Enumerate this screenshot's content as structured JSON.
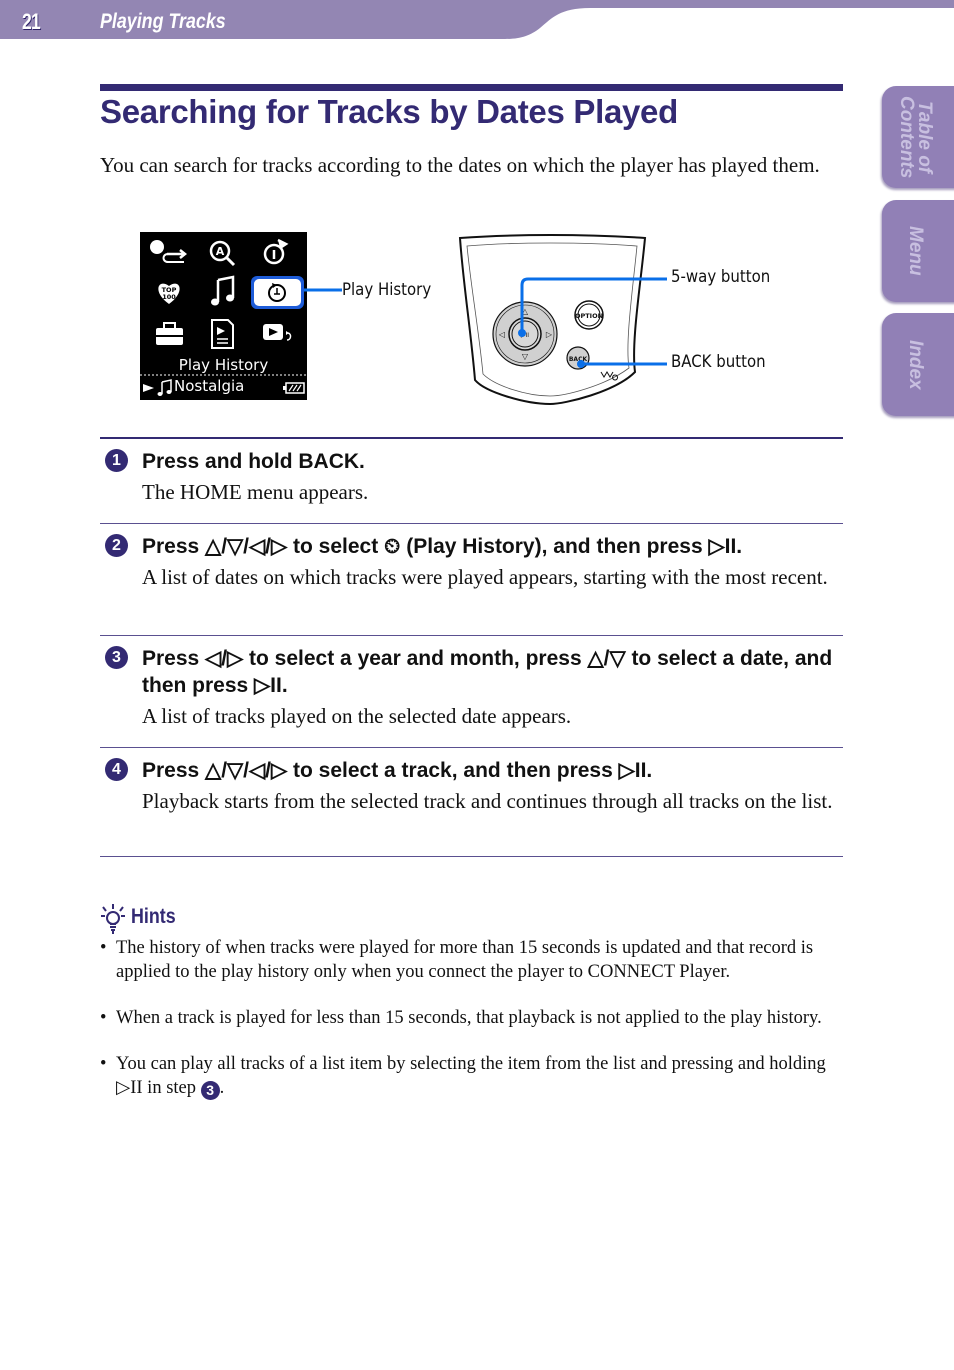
{
  "header": {
    "page_number": "21",
    "section": "Playing Tracks",
    "band_color": "#9386b3"
  },
  "side_tabs": [
    {
      "label": "Table of Contents"
    },
    {
      "label": "Menu"
    },
    {
      "label": "Index"
    }
  ],
  "title": "Searching for Tracks by Dates Played",
  "intro": "You can search for tracks according to the dates on which the player has played them.",
  "figure": {
    "screen": {
      "icons": [
        "settings-icon",
        "search-icon",
        "now-playing-icon",
        "top100-icon",
        "music-icon",
        "play-history-icon",
        "toolbox-icon",
        "playlist-icon",
        "resume-icon"
      ],
      "selected_label": "Play History",
      "now_playing_track": "Nostalgia"
    },
    "callouts": {
      "play_history": "Play History",
      "five_way": "5-way button",
      "back": "BACK button"
    },
    "device_buttons": {
      "option": "OPTION",
      "back": "BACK",
      "center": "▷II"
    },
    "accent_color": "#0a6fe8"
  },
  "steps": [
    {
      "number": "1",
      "heading": "Press and hold BACK.",
      "body": "The HOME menu appears."
    },
    {
      "number": "2",
      "heading": "Press △/▽/◁/▷ to select ⏲ (Play History), and then press ▷II.",
      "body": "A list of dates on which tracks were played appears, starting with the most recent."
    },
    {
      "number": "3",
      "heading": "Press ◁/▷ to select a year and month, press △/▽ to select a date, and then press ▷II.",
      "body": "A list of tracks played on the selected date appears."
    },
    {
      "number": "4",
      "heading": "Press △/▽/◁/▷ to select a track, and then press ▷II.",
      "body": "Playback starts from the selected track and continues through all tracks on the list."
    }
  ],
  "hints": {
    "title": "Hints",
    "items": [
      "The history of when tracks were played for more than 15 seconds is updated and that record is applied to the play history only when you connect the player to CONNECT Player.",
      "When a track is played for less than 15 seconds, that playback is not applied to the play history.",
      "You can play all tracks of a list item by selecting the item from the list and pressing and holding ▷II in step"
    ],
    "step_ref": "3"
  }
}
